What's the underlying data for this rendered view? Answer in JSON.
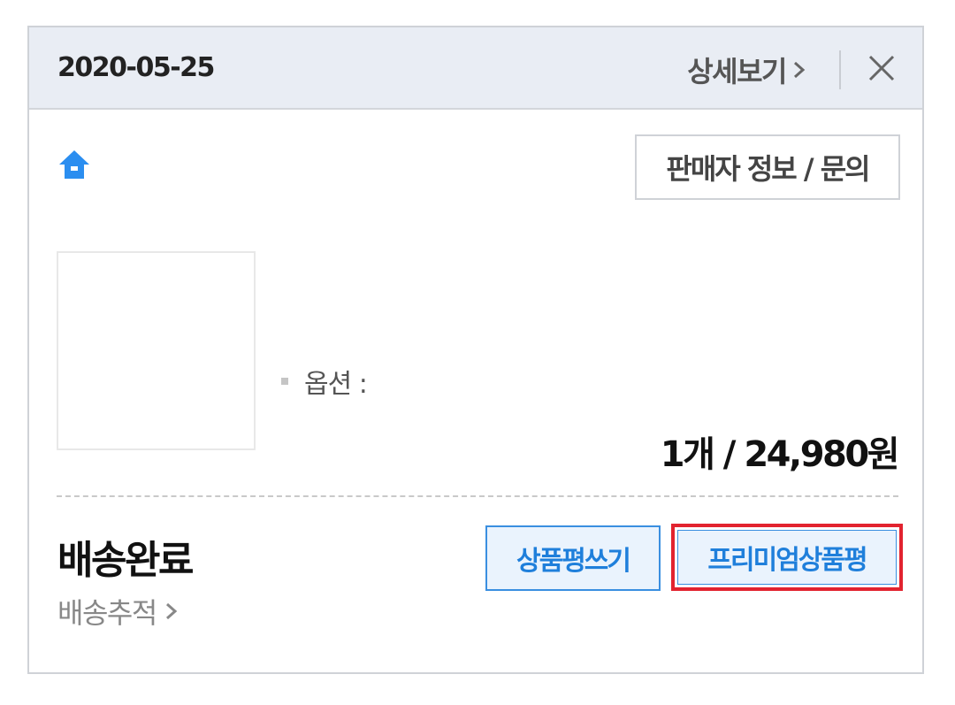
{
  "header": {
    "order_date": "2020-05-25",
    "detail_link_label": "상세보기",
    "close_icon": "close-icon"
  },
  "store": {
    "home_icon": "home-icon",
    "seller_button_label": "판매자 정보 / 문의"
  },
  "product": {
    "option_label": "옵션 :",
    "price_text": "1개 / 24,980원"
  },
  "delivery": {
    "status": "배송완료",
    "tracking_link_label": "배송추적",
    "write_review_label": "상품평쓰기",
    "premium_review_label": "프리미엄상품평"
  },
  "colors": {
    "header_bg": "#e9edf4",
    "accent_blue": "#1f7fdb",
    "button_bg": "#eaf3fd",
    "highlight_red": "#e2232f"
  }
}
